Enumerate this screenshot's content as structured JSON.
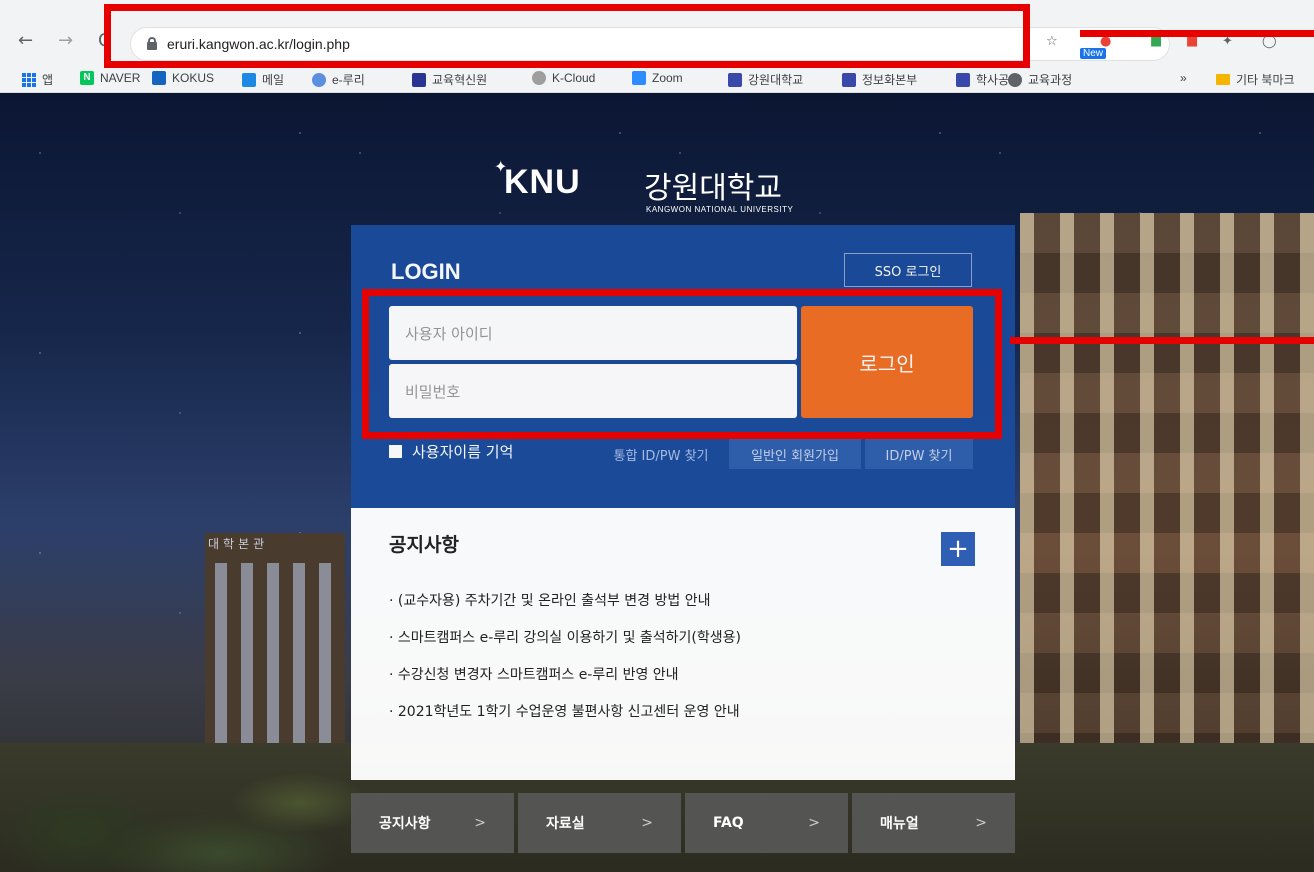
{
  "browser": {
    "url": "eruri.kangwon.ac.kr/login.php",
    "new_badge": "New",
    "bookmarks": [
      {
        "label": "앱",
        "icon": "apps-icon"
      },
      {
        "label": "NAVER",
        "icon": "naver-icon"
      },
      {
        "label": "KOKUS",
        "icon": "kokus-icon"
      },
      {
        "label": "메일",
        "icon": "mail-icon"
      },
      {
        "label": "e-루리",
        "icon": "eruri-icon"
      },
      {
        "label": "교육혁신원",
        "icon": "site-icon"
      },
      {
        "label": "K-Cloud",
        "icon": "cloud-icon"
      },
      {
        "label": "Zoom",
        "icon": "zoom-icon"
      },
      {
        "label": "강원대학교",
        "icon": "knu-icon"
      },
      {
        "label": "정보화본부",
        "icon": "knu-icon"
      },
      {
        "label": "학사공지",
        "icon": "knu-icon"
      },
      {
        "label": "교육과정",
        "icon": "globe-icon"
      },
      {
        "label": "»",
        "icon": ""
      },
      {
        "label": "기타 북마크",
        "icon": "folder-icon"
      }
    ]
  },
  "logo": {
    "name": "KNU",
    "kor": "강원대학교",
    "eng": "KANGWON NATIONAL UNIVERSITY"
  },
  "login": {
    "title": "LOGIN",
    "sso_label": "SSO 로그인",
    "id_placeholder": "사용자 아이디",
    "pw_placeholder": "비밀번호",
    "submit_label": "로그인",
    "remember_label": "사용자이름 기억",
    "links": [
      "통합 ID/PW 찾기",
      "일반인 회원가입",
      "ID/PW 찾기"
    ]
  },
  "background": {
    "building_label": "대학본관"
  },
  "notice": {
    "title": "공지사항",
    "more": "+",
    "items": [
      "· (교수자용) 주차기간 및 온라인 출석부 변경 방법 안내",
      "· 스마트캠퍼스 e-루리 강의실 이용하기 및 출석하기(학생용)",
      "· 수강신청 변경자 스마트캠퍼스 e-루리 반영 안내",
      "· 2021학년도 1학기 수업운영 불편사항 신고센터 운영 안내"
    ]
  },
  "bottom_nav": [
    {
      "label": "공지사항",
      "chevron": ">"
    },
    {
      "label": "자료실",
      "chevron": ">"
    },
    {
      "label": "FAQ",
      "chevron": ">"
    },
    {
      "label": "매뉴얼",
      "chevron": ">"
    }
  ],
  "colors": {
    "panel_blue": "#1b4b9b",
    "login_orange": "#f26f24",
    "highlight_red": "#e60000"
  }
}
